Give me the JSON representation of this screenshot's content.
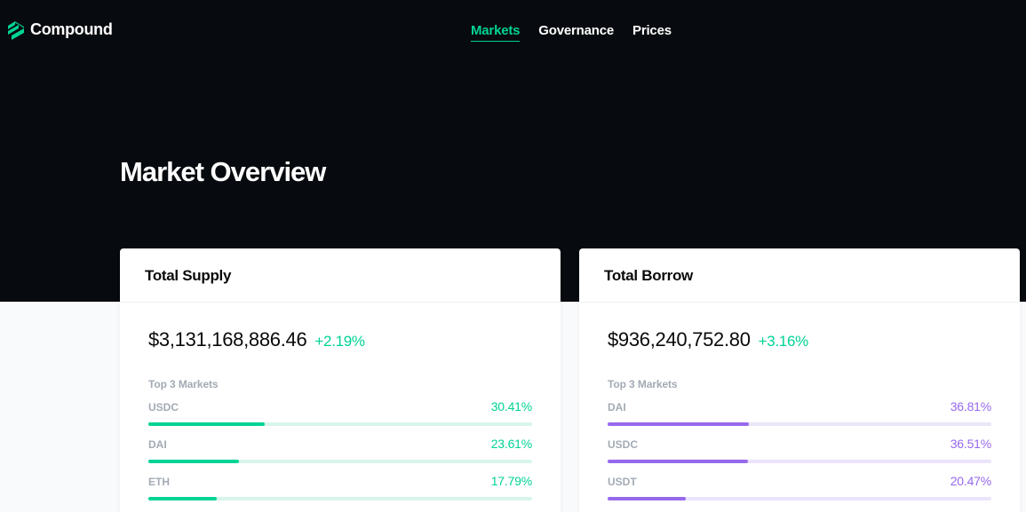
{
  "brand": {
    "name": "Compound",
    "logo_icon": "compound-logo-icon",
    "accent": "#00d395"
  },
  "nav": {
    "items": [
      {
        "label": "Markets",
        "active": true
      },
      {
        "label": "Governance",
        "active": false
      },
      {
        "label": "Prices",
        "active": false
      }
    ]
  },
  "page": {
    "title": "Market Overview"
  },
  "supply": {
    "title": "Total Supply",
    "total": "$3,131,168,886.46",
    "change": "+2.19%",
    "top_label": "Top 3 Markets",
    "color": "#00d395",
    "markets": [
      {
        "name": "USDC",
        "pct": "30.41%",
        "fraction": 0.3041
      },
      {
        "name": "DAI",
        "pct": "23.61%",
        "fraction": 0.2361
      },
      {
        "name": "ETH",
        "pct": "17.79%",
        "fraction": 0.1779
      }
    ]
  },
  "borrow": {
    "title": "Total Borrow",
    "total": "$936,240,752.80",
    "change": "+3.16%",
    "top_label": "Top 3 Markets",
    "color": "#9669ed",
    "markets": [
      {
        "name": "DAI",
        "pct": "36.81%",
        "fraction": 0.3681
      },
      {
        "name": "USDC",
        "pct": "36.51%",
        "fraction": 0.3651
      },
      {
        "name": "USDT",
        "pct": "20.47%",
        "fraction": 0.2047
      }
    ]
  }
}
